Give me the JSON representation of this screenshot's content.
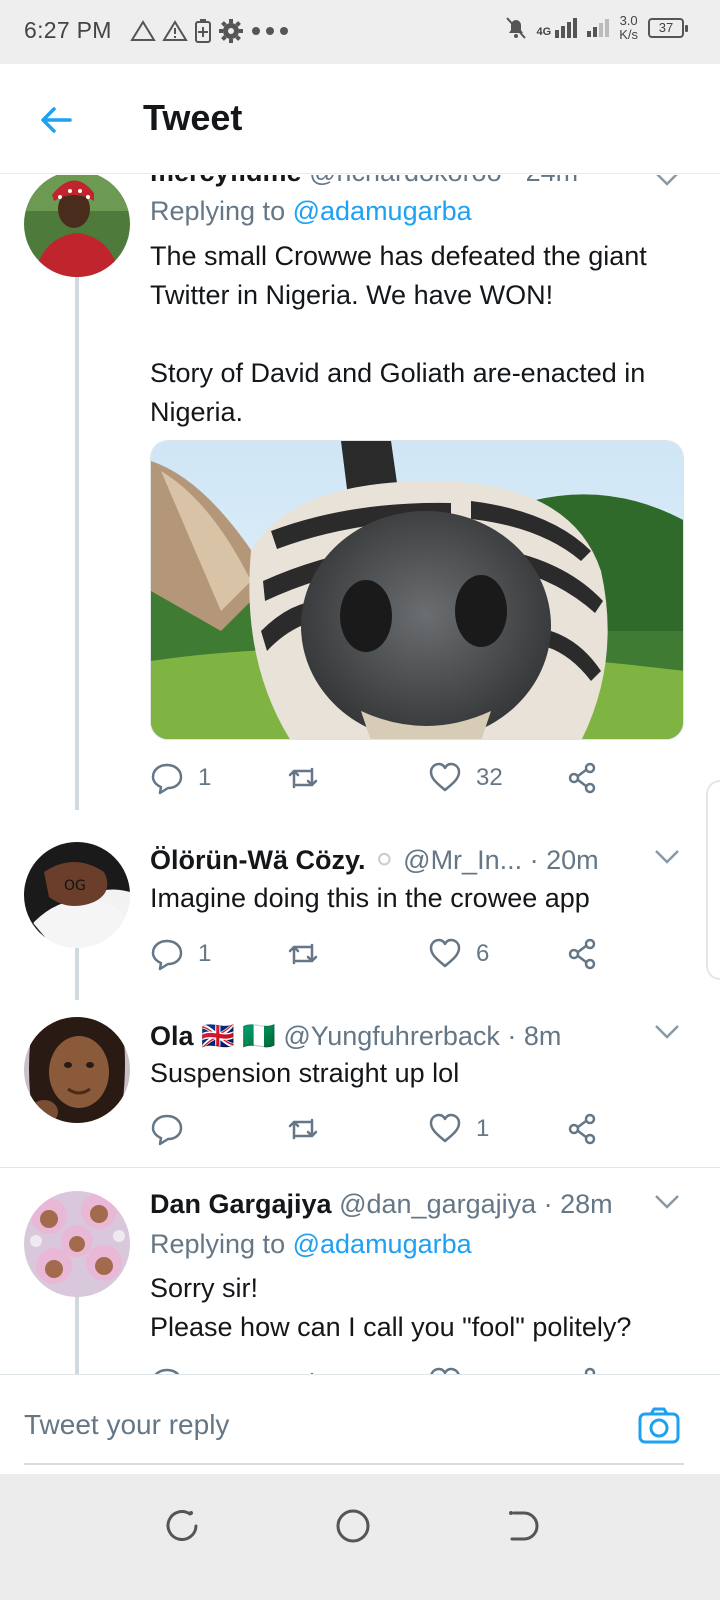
{
  "status_bar": {
    "time": "6:27 PM",
    "network": "4G",
    "speed_value": "3.0",
    "speed_unit": "K/s",
    "battery": "37",
    "icons": [
      "warning-outline-icon",
      "warning-icon",
      "battery-saver-icon",
      "gear-icon",
      "more-dots-icon",
      "mute-bell-icon",
      "signal-icon",
      "signal-icon-2"
    ]
  },
  "header": {
    "back_icon": "arrow-left-icon",
    "title": "Tweet"
  },
  "tweets": [
    {
      "name": "mercyfidme",
      "handle": "@richardokoroo",
      "time": "· 24m",
      "replying_prefix": "Replying to",
      "replying_to": "@adamugarba",
      "text": "The small Crowwe has defeated the giant Twitter in Nigeria. We have WON!\n\nStory of David and Goliath are-enacted in Nigeria.",
      "has_media": true,
      "replies": "1",
      "retweets": "",
      "likes": "32"
    },
    {
      "name": "Ölörün-Wä Cözy.",
      "name_suffix": "⚪",
      "handle": "@Mr_In...",
      "time": "· 20m",
      "text": "Imagine doing this in the crowee app",
      "replies": "1",
      "retweets": "",
      "likes": "6"
    },
    {
      "name": "Ola",
      "flags": "🇬🇧 🇳🇬",
      "handle": "@Yungfuhrerback",
      "time": "· 8m",
      "text": "Suspension straight up lol",
      "replies": "",
      "retweets": "",
      "likes": "1"
    },
    {
      "name": "Dan Gargajiya",
      "handle": "@dan_gargajiya",
      "time": "· 28m",
      "replying_prefix": "Replying to",
      "replying_to": "@adamugarba",
      "text": "Sorry sir!\nPlease how can I call you \"fool\" politely?"
    }
  ],
  "reply_bar": {
    "placeholder": "Tweet your reply",
    "camera_icon": "camera-icon"
  },
  "nav_bar": {
    "icons": [
      "recents-icon",
      "home-icon",
      "back-icon"
    ]
  },
  "colors": {
    "accent": "#1da1f2",
    "text": "#14171a",
    "muted": "#657786",
    "thread_line": "#cfd9de"
  }
}
